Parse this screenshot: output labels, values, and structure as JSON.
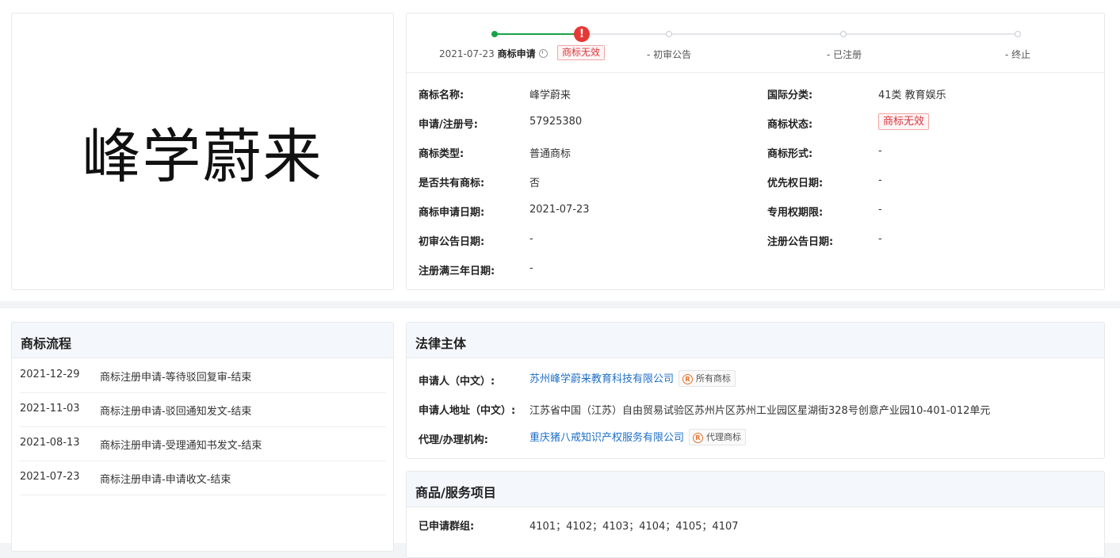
{
  "trademark": {
    "name": "峰学蔚来"
  },
  "progress": {
    "date": "2021-07-23",
    "step1": "商标申请",
    "status": "商标无效",
    "step2": "- 初审公告",
    "step3": "- 已注册",
    "step4": "- 终止",
    "colors": {
      "done": "#16a34a",
      "warn": "#e53935",
      "todo": "#c8cbd0"
    }
  },
  "details": {
    "left": [
      {
        "label": "商标名称:",
        "value": "峰学蔚来"
      },
      {
        "label": "申请/注册号:",
        "value": "57925380"
      },
      {
        "label": "商标类型:",
        "value": "普通商标"
      },
      {
        "label": "是否共有商标:",
        "value": "否"
      },
      {
        "label": "商标申请日期:",
        "value": "2021-07-23"
      },
      {
        "label": "初审公告日期:",
        "value": "-"
      },
      {
        "label": "注册满三年日期:",
        "value": "-"
      }
    ],
    "right": [
      {
        "label": "国际分类:",
        "value": "41类 教育娱乐"
      },
      {
        "label": "商标状态:",
        "value": "商标无效"
      },
      {
        "label": "商标形式:",
        "value": "-"
      },
      {
        "label": "优先权日期:",
        "value": "-"
      },
      {
        "label": "专用权期限:",
        "value": "-"
      },
      {
        "label": "注册公告日期:",
        "value": "-"
      }
    ]
  },
  "flow": {
    "title": "商标流程",
    "items": [
      {
        "date": "2021-12-29",
        "desc": "商标注册申请-等待驳回复审-结束"
      },
      {
        "date": "2021-11-03",
        "desc": "商标注册申请-驳回通知发文-结束"
      },
      {
        "date": "2021-08-13",
        "desc": "商标注册申请-受理通知书发文-结束"
      },
      {
        "date": "2021-07-23",
        "desc": "商标注册申请-申请收文-结束"
      }
    ]
  },
  "legal": {
    "title": "法律主体",
    "applicant_label": "申请人（中文）:",
    "applicant": "苏州峰学蔚来教育科技有限公司",
    "applicant_tag": "所有商标",
    "address_label": "申请人地址（中文）:",
    "address": "江苏省中国（江苏）自由贸易试验区苏州片区苏州工业园区星湖街328号创意产业园10-401-012单元",
    "agent_label": "代理/办理机构:",
    "agent": "重庆猪八戒知识产权服务有限公司",
    "agent_tag": "代理商标",
    "tag_glyph": "R"
  },
  "goods": {
    "title": "商品/服务项目",
    "group_label": "已申请群组:",
    "groups": "4101；4102；4103；4104；4105；4107"
  }
}
